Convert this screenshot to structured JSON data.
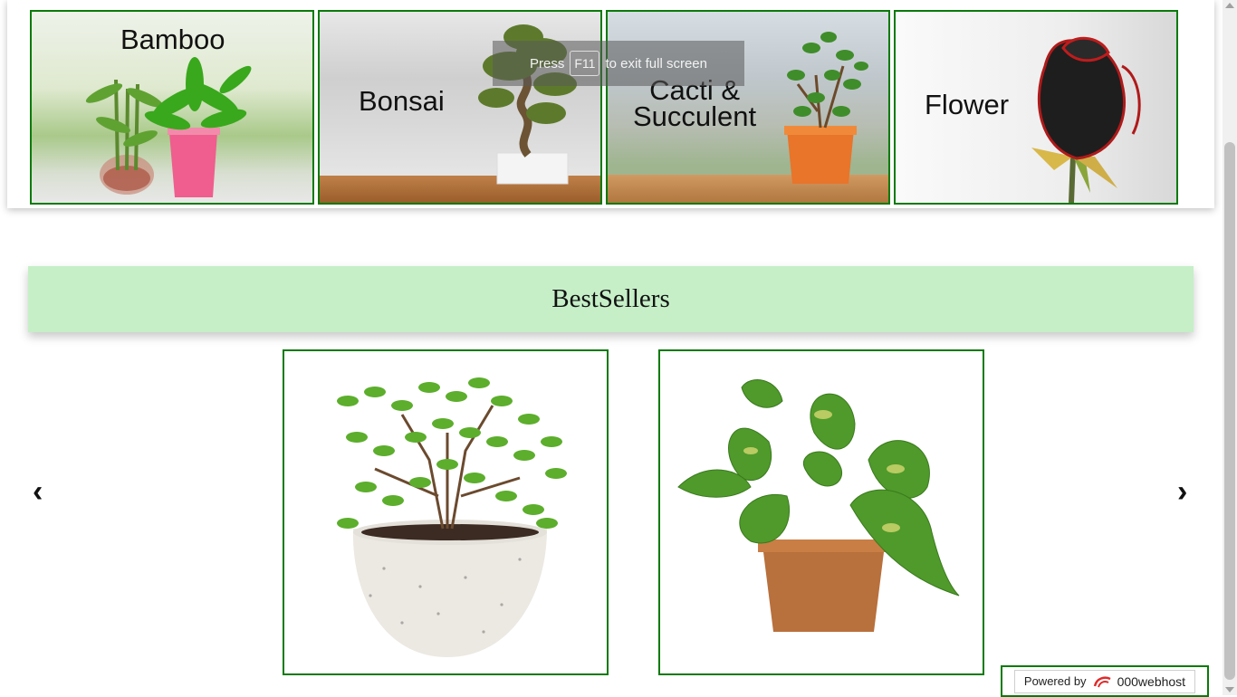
{
  "categories": [
    {
      "label": "Bamboo"
    },
    {
      "label": "Bonsai"
    },
    {
      "label": "Cacti &\nSucculent"
    },
    {
      "label": "Flower"
    }
  ],
  "toast": {
    "press": "Press",
    "key": "F11",
    "rest": "to exit full screen"
  },
  "bestsellers": {
    "title": "BestSellers",
    "prev_icon": "‹",
    "next_icon": "›",
    "products": [
      {
        "image": "jade-plant-in-speckled-pot"
      },
      {
        "image": "money-plant-in-brown-pot"
      }
    ]
  },
  "footer": {
    "powered_by": "Powered by",
    "brand": "000webhost"
  },
  "colors": {
    "border": "#0a7a0a",
    "header_bg": "#c6efc8"
  }
}
